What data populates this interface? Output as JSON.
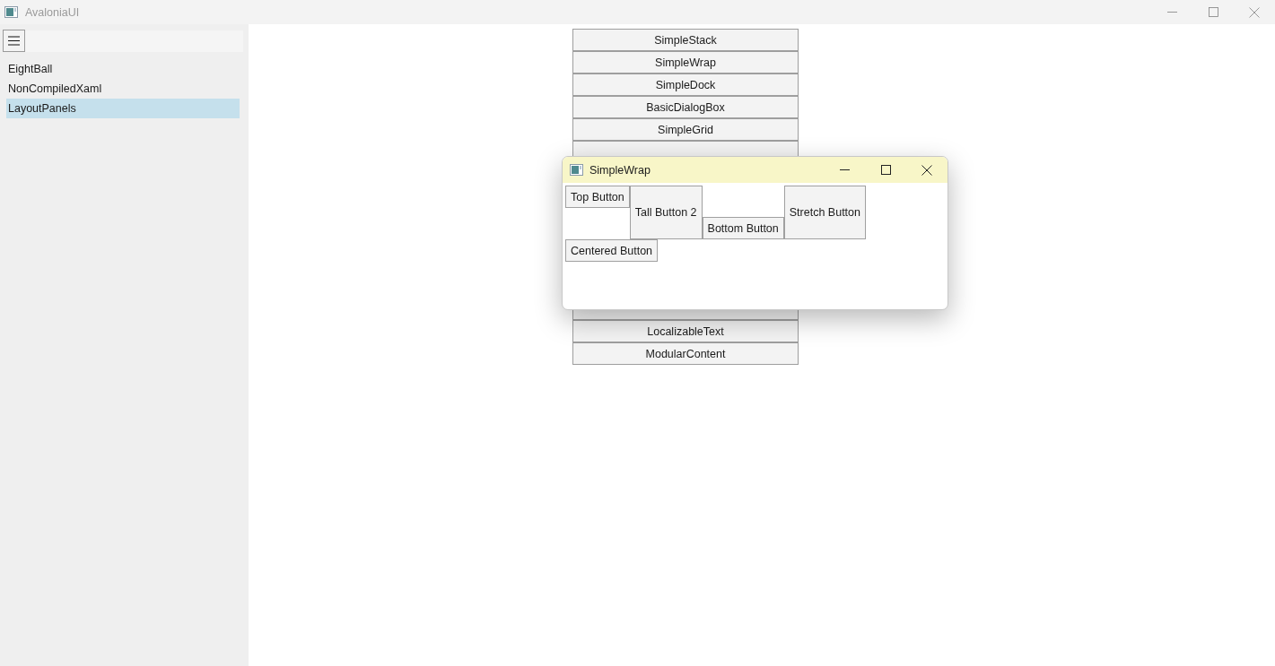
{
  "window": {
    "title": "AvaloniaUI"
  },
  "sidebar": {
    "items": [
      {
        "label": "EightBall",
        "selected": false
      },
      {
        "label": "NonCompiledXaml",
        "selected": false
      },
      {
        "label": "LayoutPanels",
        "selected": true
      }
    ]
  },
  "samples": {
    "above": [
      "SimpleStack",
      "SimpleWrap",
      "SimpleDock",
      "BasicDialogBox",
      "SimpleGrid"
    ],
    "below": [
      "LocalizableText",
      "ModularContent"
    ]
  },
  "dialog": {
    "title": "SimpleWrap",
    "buttons": [
      {
        "label": "Top Button",
        "kind": "top"
      },
      {
        "label": "Tall Button 2",
        "kind": "tall"
      },
      {
        "label": "Bottom Button",
        "kind": "bottom"
      },
      {
        "label": "Stretch Button",
        "kind": "stretch"
      },
      {
        "label": "Centered Button",
        "kind": "centered"
      }
    ]
  }
}
